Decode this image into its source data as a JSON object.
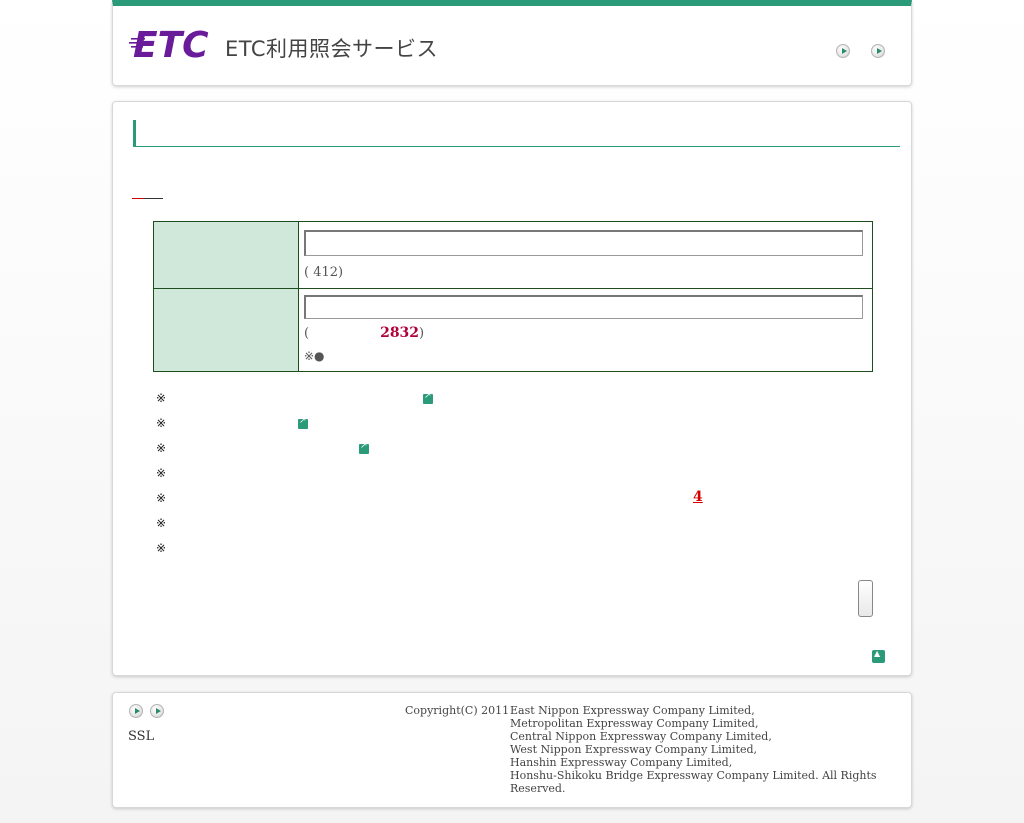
{
  "header": {
    "logo_text": "ETC",
    "service_title": "ETC利用照会サービス",
    "nav_buttons": [
      "arrow-right",
      "arrow-right"
    ]
  },
  "form": {
    "row1_hint": "( 412)",
    "row2_hint_open": "(",
    "row2_hint_number": "2832",
    "row2_hint_close": ")",
    "row2_note": "※●"
  },
  "notes": {
    "mark": "※",
    "highlight_number": "4"
  },
  "footer": {
    "ssl_label": "SSL",
    "copyright_label": "Copyright(C) 2011",
    "companies": [
      "East Nippon Expressway Company Limited,",
      "Metropolitan Expressway Company Limited,",
      "Central Nippon Expressway Company Limited,",
      "West Nippon Expressway Company Limited,",
      "Hanshin Expressway Company Limited,",
      "Honshu-Shikoku Bridge Expressway Company Limited. All Rights Reserved."
    ]
  },
  "colors": {
    "accent": "#2a9a78",
    "label_cell_bg": "#cfe8da",
    "logo_purple": "#6a1b9a",
    "highlight_red": "#d40000",
    "hint_number": "#b0003a"
  }
}
